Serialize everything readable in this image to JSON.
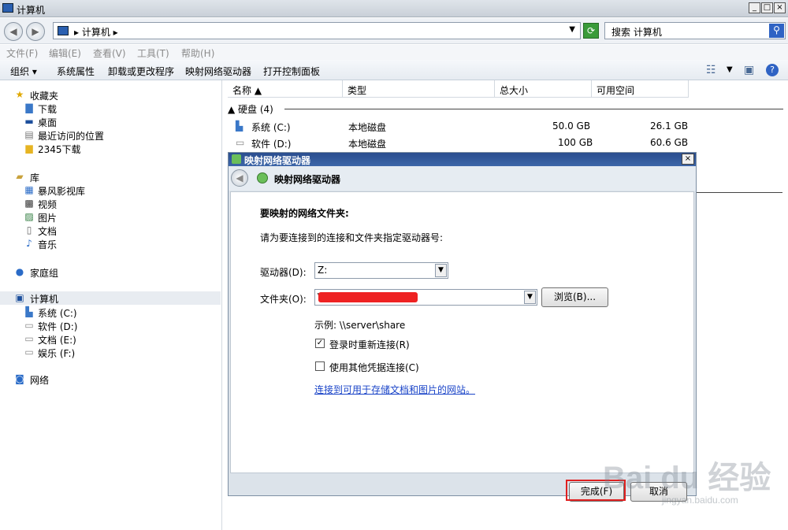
{
  "window": {
    "title": "计算机",
    "min": "_",
    "max": "□",
    "close": "×"
  },
  "address": {
    "breadcrumb": "▸ 计算机 ▸",
    "dropdown": "▼",
    "refresh": "⟳"
  },
  "search": {
    "placeholder": "搜索 计算机",
    "icon": "search-icon"
  },
  "menu": [
    "文件(F)",
    "编辑(E)",
    "查看(V)",
    "工具(T)",
    "帮助(H)"
  ],
  "toolbar": {
    "organize": "组织 ▾",
    "system_props": "系统属性",
    "uninstall": "卸载或更改程序",
    "map_drive": "映射网络驱动器",
    "control_panel": "打开控制面板"
  },
  "sidebar": {
    "favorites": {
      "label": "收藏夹",
      "items": [
        "下载",
        "桌面",
        "最近访问的位置",
        "2345下载"
      ]
    },
    "library": {
      "label": "库",
      "items": [
        "暴风影视库",
        "视频",
        "图片",
        "文档",
        "音乐"
      ]
    },
    "homegroup": "家庭组",
    "computer": {
      "label": "计算机",
      "items": [
        "系统 (C:)",
        "软件 (D:)",
        "文档 (E:)",
        "娱乐 (F:)"
      ]
    },
    "network": "网络"
  },
  "columns": {
    "name": "名称 ▲",
    "type": "类型",
    "total": "总大小",
    "free": "可用空间"
  },
  "group": {
    "label": "▲ 硬盘 (4)"
  },
  "drives": [
    {
      "name": "系统 (C:)",
      "type": "本地磁盘",
      "total": "50.0 GB",
      "free": "26.1 GB"
    },
    {
      "name": "软件 (D:)",
      "type": "本地磁盘",
      "total": "100 GB",
      "free": "60.6 GB"
    }
  ],
  "dialog": {
    "title": "映射网络驱动器",
    "close": "×",
    "header": "映射网络驱动器",
    "heading": "要映射的网络文件夹:",
    "instruction": "请为要连接到的连接和文件夹指定驱动器号:",
    "drive_label": "驱动器(D):",
    "drive_value": "Z:",
    "folder_label": "文件夹(O):",
    "folder_value": "\\\\",
    "browse": "浏览(B)...",
    "example": "示例: \\\\server\\share",
    "reconnect": "登录时重新连接(R)",
    "reconnect_checked": "✓",
    "other_creds": "使用其他凭据连接(C)",
    "link": "连接到可用于存储文档和图片的网站。",
    "finish": "完成(F)",
    "cancel": "取消"
  },
  "watermark": {
    "brand": "Bai du 经验",
    "url": "jingyan.baidu.com"
  }
}
